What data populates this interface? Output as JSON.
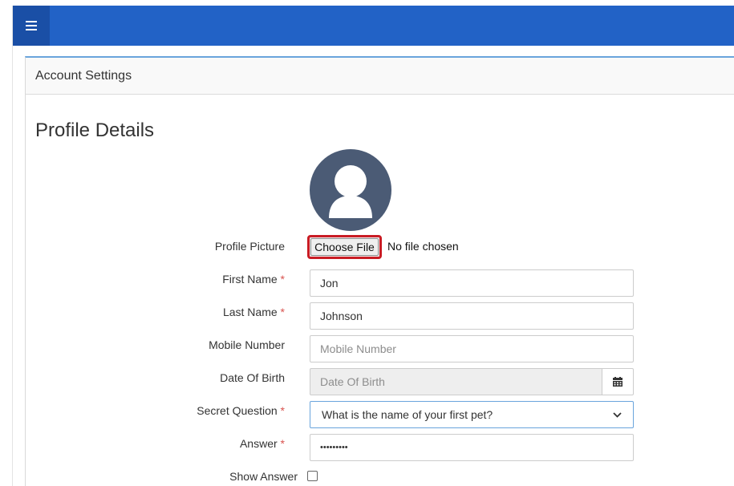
{
  "panel": {
    "title": "Account Settings"
  },
  "section": {
    "title": "Profile Details"
  },
  "profile_picture": {
    "label": "Profile Picture",
    "button_label": "Choose File",
    "status": "No file chosen"
  },
  "first_name": {
    "label": "First Name",
    "required_mark": "*",
    "value": "Jon"
  },
  "last_name": {
    "label": "Last Name",
    "required_mark": "*",
    "value": "Johnson"
  },
  "mobile_number": {
    "label": "Mobile Number",
    "placeholder": "Mobile Number"
  },
  "date_of_birth": {
    "label": "Date Of Birth",
    "placeholder": "Date Of Birth"
  },
  "secret_question": {
    "label": "Secret Question",
    "required_mark": "*",
    "selected": "What is the name of your first pet?"
  },
  "answer": {
    "label": "Answer",
    "required_mark": "*",
    "value": "•••••••••"
  },
  "show_answer": {
    "label": "Show Answer",
    "checked": false
  },
  "colors": {
    "navbar": "#2262c6",
    "menu_button": "#1a4fa6",
    "highlight": "#c91c24",
    "avatar": "#4b5b75",
    "required": "#d9534f"
  },
  "icons": {
    "menu": "hamburger-icon",
    "calendar": "calendar-icon",
    "dropdown": "chevron-down-icon",
    "avatar": "user-silhouette-icon"
  }
}
